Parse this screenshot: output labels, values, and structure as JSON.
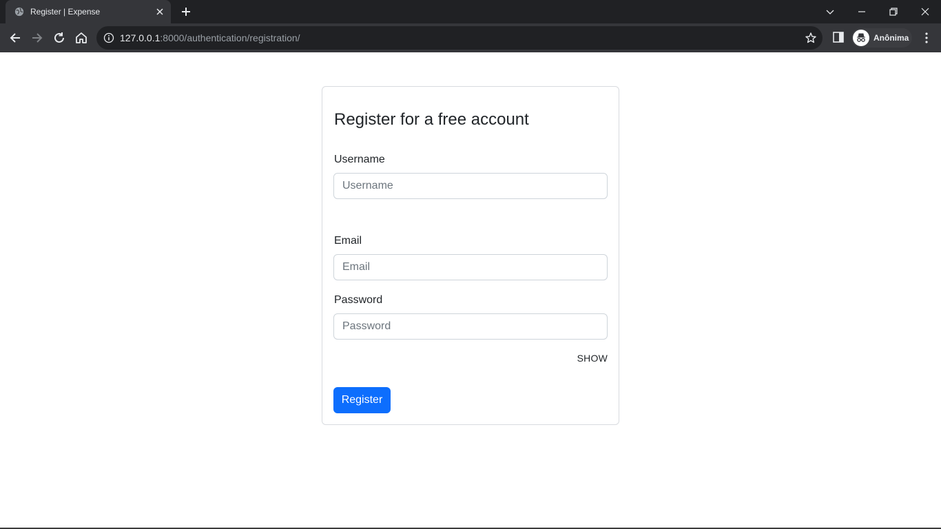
{
  "browser": {
    "tab_title": "Register | Expense",
    "url_host": "127.0.0.1",
    "url_rest": ":8000/authentication/registration/",
    "profile_label": "Anônima",
    "colors": {
      "chrome_dark": "#202124",
      "chrome_toolbar": "#35363a",
      "text_light": "#e8eaed"
    }
  },
  "form": {
    "title": "Register for a free account",
    "username": {
      "label": "Username",
      "placeholder": "Username",
      "value": ""
    },
    "email": {
      "label": "Email",
      "placeholder": "Email",
      "value": ""
    },
    "password": {
      "label": "Password",
      "placeholder": "Password",
      "value": ""
    },
    "show_toggle": "SHOW",
    "submit_label": "Register",
    "colors": {
      "primary": "#0d6efd",
      "border": "#ced4da"
    }
  }
}
